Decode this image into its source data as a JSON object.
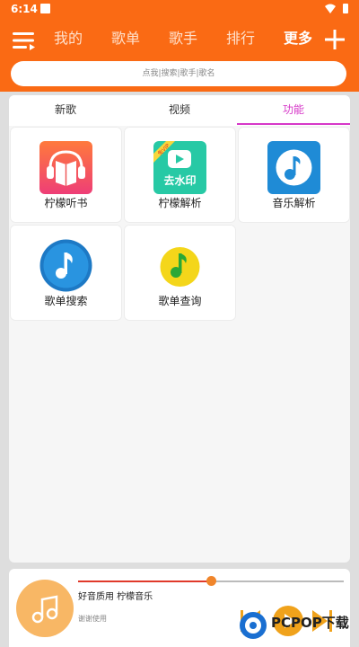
{
  "status_bar": {
    "time": "6:14"
  },
  "nav": {
    "tabs": [
      "我的",
      "歌单",
      "歌手",
      "排行",
      "更多"
    ],
    "active_index": 4
  },
  "search": {
    "placeholder": "点我|搜索|歌手|歌名"
  },
  "content_tabs": {
    "items": [
      "新歌",
      "视频",
      "功能"
    ],
    "active_index": 2
  },
  "functions": [
    {
      "label": "柠檬听书",
      "icon": "headphones-book-icon"
    },
    {
      "label": "柠檬解析",
      "icon": "watermark-remove-icon",
      "icon_text": "去水印",
      "badge": "免VIP"
    },
    {
      "label": "音乐解析",
      "icon": "music-note-icon"
    },
    {
      "label": "歌单搜索",
      "icon": "music-note-icon"
    },
    {
      "label": "歌单查询",
      "icon": "music-note-icon"
    }
  ],
  "player": {
    "title": "好音质用 柠檬音乐",
    "subtitle": "谢谢使用",
    "progress": 0.5
  },
  "watermark": {
    "text": "PCPOP下载"
  },
  "colors": {
    "header": "#fa6a14",
    "tab_active": "#d638c8",
    "progress": "#e0392a",
    "album": "#f8b765"
  }
}
